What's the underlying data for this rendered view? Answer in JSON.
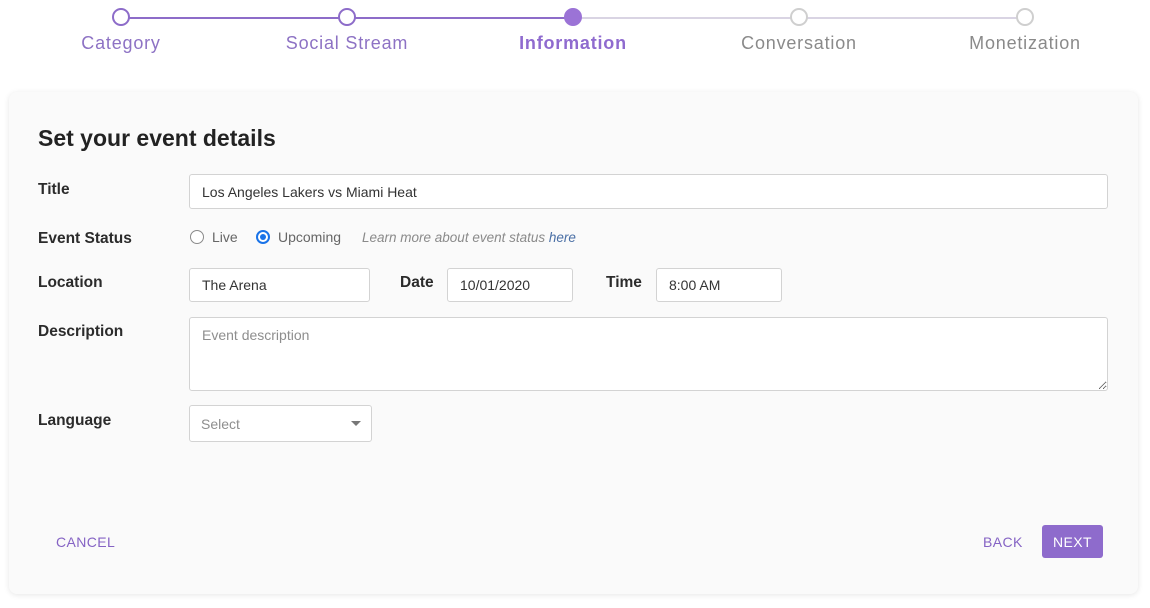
{
  "stepper": {
    "steps": [
      {
        "label": "Category",
        "state": "done"
      },
      {
        "label": "Social Stream",
        "state": "done"
      },
      {
        "label": "Information",
        "state": "current"
      },
      {
        "label": "Conversation",
        "state": "todo"
      },
      {
        "label": "Monetization",
        "state": "todo"
      }
    ]
  },
  "form": {
    "heading": "Set your event details",
    "title": {
      "label": "Title",
      "value": "Los Angeles Lakers vs Miami Heat"
    },
    "event_status": {
      "label": "Event Status",
      "options": [
        {
          "label": "Live",
          "checked": false
        },
        {
          "label": "Upcoming",
          "checked": true
        }
      ],
      "note_text": "Learn more about event status ",
      "note_link": "here"
    },
    "location": {
      "label": "Location",
      "value": "The Arena"
    },
    "date": {
      "label": "Date",
      "value": "10/01/2020"
    },
    "time": {
      "label": "Time",
      "value": "8:00 AM"
    },
    "description": {
      "label": "Description",
      "placeholder": "Event description",
      "value": ""
    },
    "language": {
      "label": "Language",
      "selected": "Select"
    }
  },
  "actions": {
    "cancel": "CANCEL",
    "back": "BACK",
    "next": "NEXT"
  },
  "colors": {
    "accent": "#8e6bcc",
    "radio_checked": "#1a73e8",
    "step_inactive": "#cfcfcf"
  }
}
